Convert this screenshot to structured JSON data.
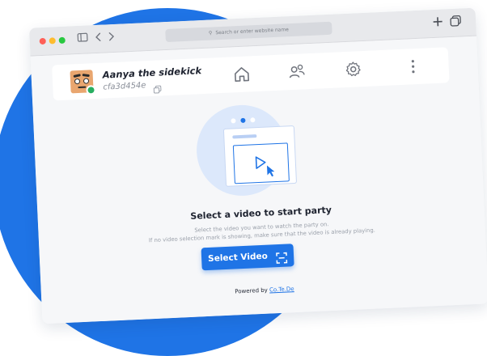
{
  "browser": {
    "address_placeholder": "Search or enter website name"
  },
  "profile": {
    "name": "Aanya the sidekick",
    "user_id": "cfa3d454e",
    "status": "online"
  },
  "nav": {
    "icons": [
      "home-icon",
      "users-icon",
      "settings-icon",
      "more-vertical-icon"
    ]
  },
  "main": {
    "headline": "Select a video to start party",
    "hint_line1": "Select the video you want to watch the party on.",
    "hint_line2": "If no video selection mark is showing, make sure that the video is already playing.",
    "button_label": "Select Video"
  },
  "footer": {
    "prefix": "Powered by",
    "brand": "Co.Te.De"
  },
  "colors": {
    "accent": "#1f74e6",
    "status_online": "#27ae60",
    "avatar_bg": "#e9a66f"
  }
}
